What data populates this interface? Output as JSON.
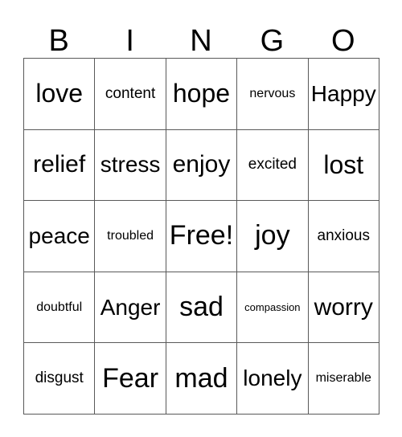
{
  "card": {
    "title": "BINGO",
    "header_letters": [
      "B",
      "I",
      "N",
      "G",
      "O"
    ],
    "free_space_label": "Free!",
    "colors": {
      "background": "#ffffff",
      "text": "#000000",
      "grid_line": "#595959",
      "outer_border": "#7d7d7d"
    },
    "rows": [
      [
        {
          "text": "love",
          "size": "t-lg"
        },
        {
          "text": "content",
          "size": "t-xs"
        },
        {
          "text": "hope",
          "size": "t-lg"
        },
        {
          "text": "nervous",
          "size": "t-xxs"
        },
        {
          "text": "Happy",
          "size": "t-md"
        }
      ],
      [
        {
          "text": "relief",
          "size": "t-ml"
        },
        {
          "text": "stress",
          "size": "t-md"
        },
        {
          "text": "enjoy",
          "size": "t-ml"
        },
        {
          "text": "excited",
          "size": "t-xs"
        },
        {
          "text": "lost",
          "size": "t-lg"
        }
      ],
      [
        {
          "text": "peace",
          "size": "t-md"
        },
        {
          "text": "troubled",
          "size": "t-xxs"
        },
        {
          "text": "Free!",
          "size": "t-xl"
        },
        {
          "text": "joy",
          "size": "t-xl"
        },
        {
          "text": "anxious",
          "size": "t-xs"
        }
      ],
      [
        {
          "text": "doubtful",
          "size": "t-xxs"
        },
        {
          "text": "Anger",
          "size": "t-md"
        },
        {
          "text": "sad",
          "size": "t-xl"
        },
        {
          "text": "compassion",
          "size": "t-tiny"
        },
        {
          "text": "worry",
          "size": "t-ml"
        }
      ],
      [
        {
          "text": "disgust",
          "size": "t-xs"
        },
        {
          "text": "Fear",
          "size": "t-xl"
        },
        {
          "text": "mad",
          "size": "t-xl"
        },
        {
          "text": "lonely",
          "size": "t-md"
        },
        {
          "text": "miserable",
          "size": "t-xxs"
        }
      ]
    ]
  }
}
